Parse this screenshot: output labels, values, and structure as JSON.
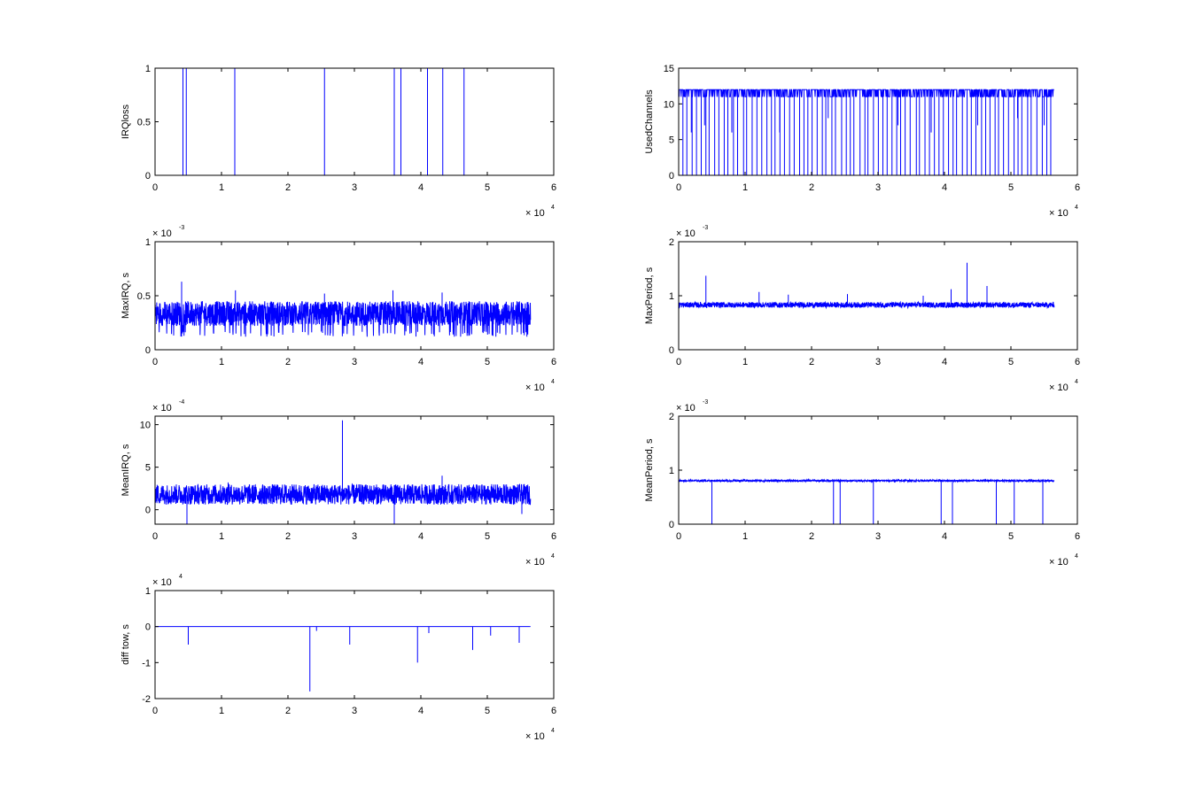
{
  "figure": {
    "background": "#ffffff",
    "axis_color": "#000000"
  },
  "chart_data": [
    {
      "type": "line",
      "color": "#0000ff",
      "ylabel": "IRQloss",
      "xlim": [
        0,
        60000
      ],
      "ylim": [
        0,
        1
      ],
      "xticks": [
        0,
        1,
        2,
        3,
        4,
        5,
        6
      ],
      "yticks": [
        "0",
        "0.5",
        "1"
      ],
      "x_exponent": "4",
      "y_exponent": "",
      "baseline": 0,
      "data_end": 56500,
      "noise": 0,
      "spikes": [
        [
          4200,
          1
        ],
        [
          4700,
          1
        ],
        [
          12000,
          1
        ],
        [
          25500,
          1
        ],
        [
          36000,
          1
        ],
        [
          37000,
          1
        ],
        [
          41000,
          1
        ],
        [
          43300,
          1
        ],
        [
          46500,
          1
        ]
      ]
    },
    {
      "type": "line",
      "color": "#0000ff",
      "ylabel": "UsedChannels",
      "xlim": [
        0,
        60000
      ],
      "ylim": [
        0,
        15
      ],
      "xticks": [
        0,
        1,
        2,
        3,
        4,
        5,
        6
      ],
      "yticks": [
        "0",
        "5",
        "10",
        "15"
      ],
      "x_exponent": "4",
      "y_exponent": "",
      "baseline": 12,
      "baseline_dips_to": 11,
      "data_end": 56500,
      "noise": 0,
      "drops_to_zero_count": 80,
      "drops_partial": [
        [
          1900,
          6
        ],
        [
          3900,
          7
        ],
        [
          8000,
          6
        ],
        [
          15200,
          6
        ],
        [
          22500,
          8
        ],
        [
          33000,
          7
        ],
        [
          38000,
          6
        ],
        [
          45000,
          7
        ],
        [
          51000,
          8
        ],
        [
          55000,
          7
        ]
      ]
    },
    {
      "type": "line",
      "color": "#0000ff",
      "ylabel": "MaxIRQ, s",
      "xlim": [
        0,
        60000
      ],
      "ylim": [
        0,
        1
      ],
      "xticks": [
        0,
        1,
        2,
        3,
        4,
        5,
        6
      ],
      "yticks": [
        "0",
        "0.5",
        "1"
      ],
      "x_exponent": "4",
      "y_exponent": "-3",
      "baseline": 0.3,
      "noise_upper": 0.45,
      "noise_lower": 0.22,
      "dips_to": 0.12,
      "data_end": 56500,
      "spikes": [
        [
          4000,
          0.63
        ],
        [
          12100,
          0.55
        ],
        [
          25500,
          0.52
        ],
        [
          35800,
          0.55
        ],
        [
          43200,
          0.53
        ]
      ]
    },
    {
      "type": "line",
      "color": "#0000ff",
      "ylabel": "MaxPeriod, s",
      "xlim": [
        0,
        60000
      ],
      "ylim": [
        0,
        2
      ],
      "xticks": [
        0,
        1,
        2,
        3,
        4,
        5,
        6
      ],
      "yticks": [
        "0",
        "1",
        "2"
      ],
      "x_exponent": "4",
      "y_exponent": "-3",
      "baseline": 0.83,
      "noise_upper": 0.88,
      "noise_lower": 0.78,
      "data_end": 56500,
      "spikes": [
        [
          4100,
          1.37
        ],
        [
          12100,
          1.07
        ],
        [
          16500,
          1.02
        ],
        [
          25400,
          1.03
        ],
        [
          36800,
          1.0
        ],
        [
          41000,
          1.12
        ],
        [
          43400,
          1.61
        ],
        [
          46400,
          1.18
        ]
      ]
    },
    {
      "type": "line",
      "color": "#0000ff",
      "ylabel": "MeanIRQ, s",
      "xlim": [
        0,
        60000
      ],
      "ylim": [
        -1.7,
        11
      ],
      "xticks": [
        0,
        1,
        2,
        3,
        4,
        5,
        6
      ],
      "yticks": [
        "0",
        "5",
        "10"
      ],
      "x_exponent": "4",
      "y_exponent": "-4",
      "baseline": 1.7,
      "noise_upper": 3.0,
      "noise_lower": 0.6,
      "data_end": 56500,
      "spikes": [
        [
          28200,
          10.5
        ],
        [
          43200,
          4.0
        ],
        [
          11000,
          3.2
        ]
      ],
      "dips": [
        [
          4800,
          -1.7
        ],
        [
          36000,
          -1.7
        ],
        [
          55200,
          -0.5
        ]
      ]
    },
    {
      "type": "line",
      "color": "#0000ff",
      "ylabel": "MeanPeriod, s",
      "xlim": [
        0,
        60000
      ],
      "ylim": [
        0,
        2
      ],
      "xticks": [
        0,
        1,
        2,
        3,
        4,
        5,
        6
      ],
      "yticks": [
        "0",
        "1",
        "2"
      ],
      "x_exponent": "4",
      "y_exponent": "-3",
      "baseline": 0.8,
      "noise_upper": 0.82,
      "noise_lower": 0.79,
      "data_end": 56500,
      "dips": [
        [
          5000,
          0
        ],
        [
          23300,
          0
        ],
        [
          24300,
          0
        ],
        [
          29300,
          0
        ],
        [
          39500,
          0
        ],
        [
          41200,
          0
        ],
        [
          47800,
          0
        ],
        [
          50500,
          0
        ],
        [
          54800,
          0
        ]
      ]
    },
    {
      "type": "line",
      "color": "#0000ff",
      "ylabel": "diff tow, s",
      "xlim": [
        0,
        60000
      ],
      "ylim": [
        -2,
        1
      ],
      "xticks": [
        0,
        1,
        2,
        3,
        4,
        5,
        6
      ],
      "yticks": [
        "-2",
        "-1",
        "0",
        "1"
      ],
      "x_exponent": "4",
      "y_exponent": "4",
      "baseline": 0,
      "data_end": 56500,
      "noise": 0,
      "dips": [
        [
          5000,
          -0.5
        ],
        [
          23300,
          -1.8
        ],
        [
          24300,
          -0.12
        ],
        [
          29300,
          -0.5
        ],
        [
          39500,
          -1.0
        ],
        [
          41200,
          -0.18
        ],
        [
          47800,
          -0.65
        ],
        [
          50500,
          -0.25
        ],
        [
          54800,
          -0.45
        ]
      ]
    }
  ]
}
